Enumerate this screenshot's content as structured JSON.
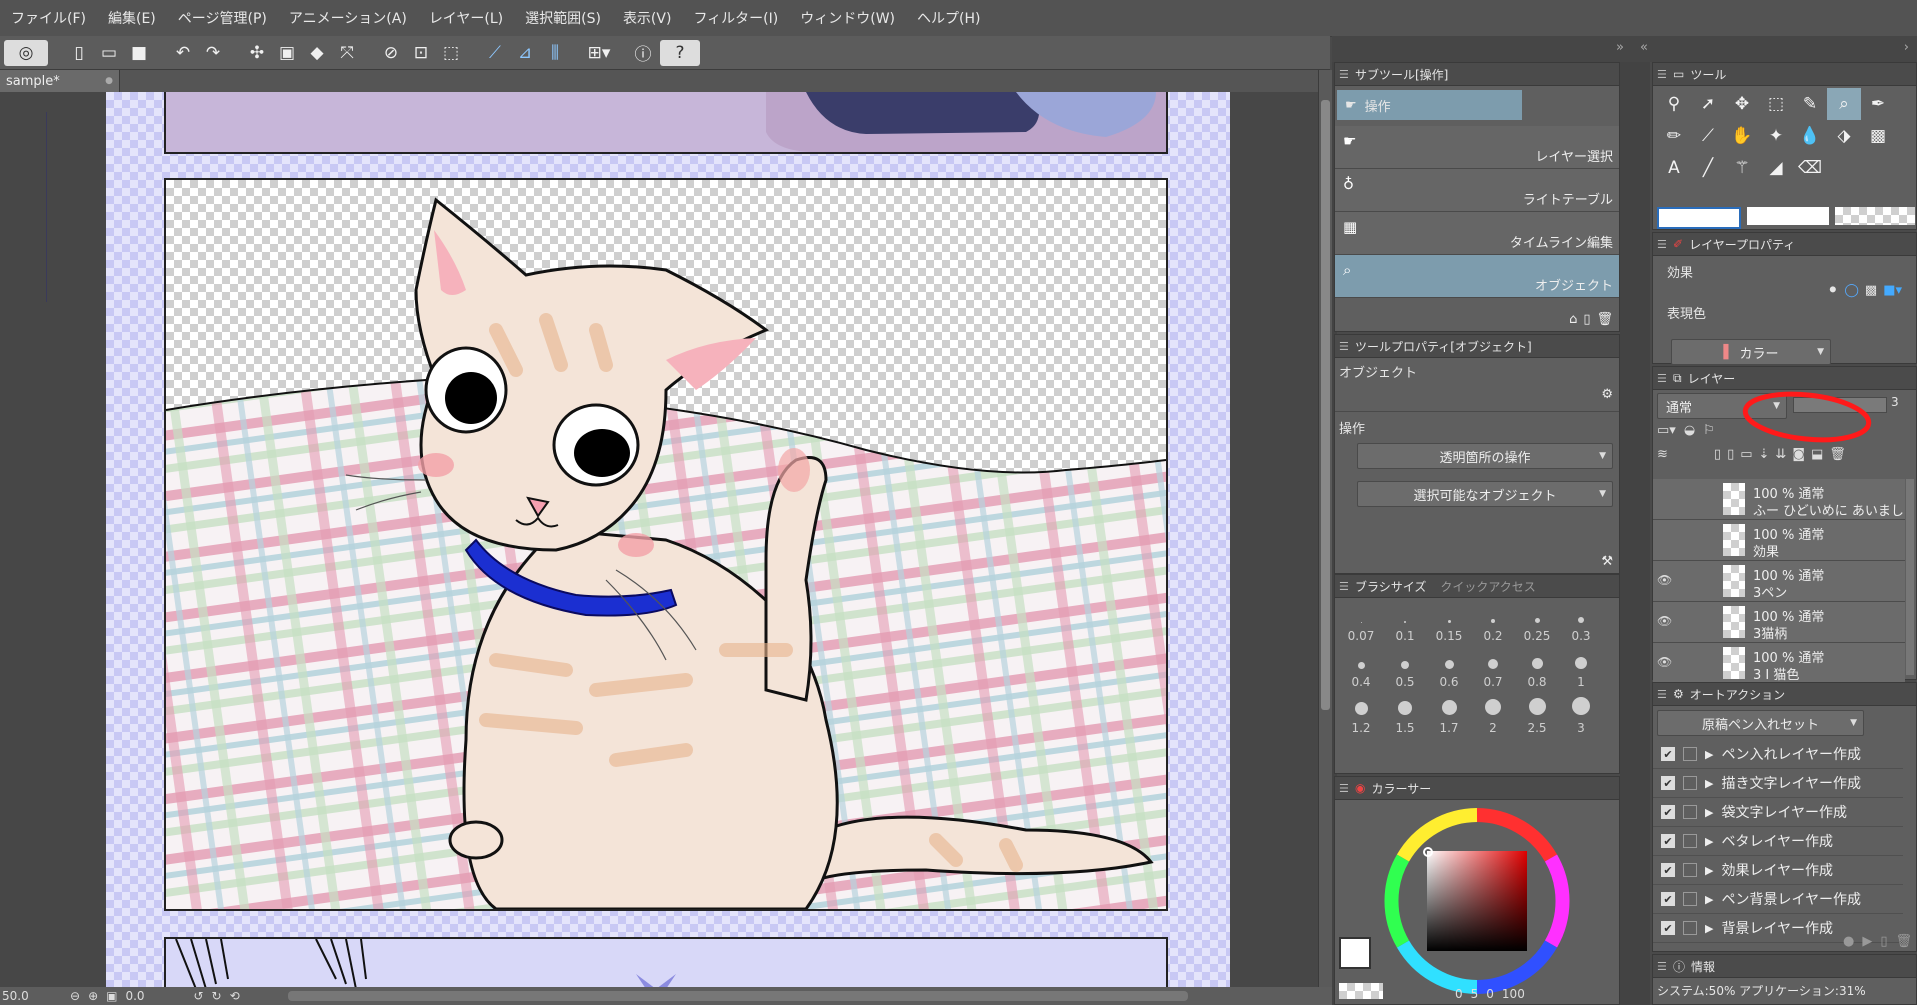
{
  "menu": [
    "ファイル(F)",
    "編集(E)",
    "ページ管理(P)",
    "アニメーション(A)",
    "レイヤー(L)",
    "選択範囲(S)",
    "表示(V)",
    "フィルター(I)",
    "ウィンドウ(W)",
    "ヘルプ(H)"
  ],
  "doc_tab": {
    "name": "sample*"
  },
  "status": {
    "zoom": "50.0",
    "angle": "0.0"
  },
  "subtool": {
    "title": "サブツール[操作]",
    "header_item": "操作",
    "items": [
      "レイヤー選択",
      "ライトテーブル",
      "タイムライン編集",
      "オブジェクト"
    ]
  },
  "toolprop": {
    "title": "ツールプロパティ[オブジェクト]",
    "section1": "オブジェクト",
    "section2": "操作",
    "option1": "透明箇所の操作",
    "option2": "選択可能なオブジェクト"
  },
  "brush": {
    "tab1": "ブラシサイズ",
    "tab2": "クイックアクセス",
    "sizes": [
      "0.07",
      "0.1",
      "0.15",
      "0.2",
      "0.25",
      "0.3",
      "0.4",
      "0.5",
      "0.6",
      "0.7",
      "0.8",
      "1",
      "1.2",
      "1.5",
      "1.7",
      "2",
      "2.5",
      "3"
    ]
  },
  "color": {
    "title": "カラーサー",
    "h": "0",
    "s": "5",
    "v": "0",
    "v2": "100"
  },
  "tool_panel": {
    "title": "ツール"
  },
  "layer_prop": {
    "title": "レイヤープロパティ",
    "effect_label": "効果",
    "expression_label": "表現色",
    "expression_value": "カラー"
  },
  "layers": {
    "title": "レイヤー",
    "blend": "通常",
    "opacity": "3",
    "items": [
      {
        "line1": "100 % 通常",
        "line2": "ふー ひどいめに あいまし"
      },
      {
        "line1": "100 % 通常",
        "line2": "効果"
      },
      {
        "line1": "100 % 通常",
        "line2": "3ペン"
      },
      {
        "line1": "100 % 通常",
        "line2": "3猫柄"
      },
      {
        "line1": "100 % 通常",
        "line2": "3 I 猫色"
      }
    ]
  },
  "auto_action": {
    "title": "オートアクション",
    "set": "原稿ペン入れセット",
    "items": [
      "ペン入れレイヤー作成",
      "描き文字レイヤー作成",
      "袋文字レイヤー作成",
      "ベタレイヤー作成",
      "効果レイヤー作成",
      "ペン背景レイヤー作成",
      "背景レイヤー作成"
    ]
  },
  "info": {
    "title": "情報",
    "text": "システム:50% アプリケーション:31%"
  }
}
